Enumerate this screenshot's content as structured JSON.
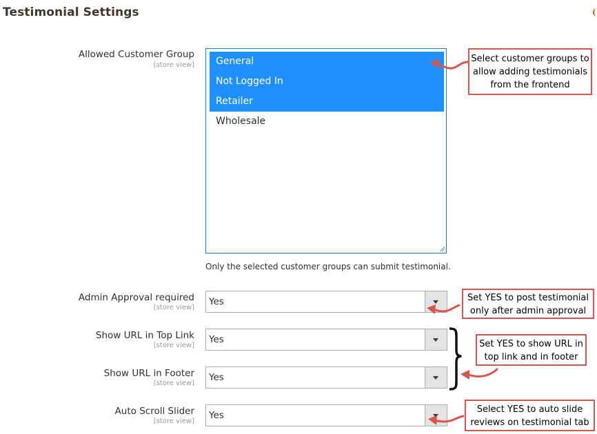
{
  "section": {
    "title": "Testimonial Settings"
  },
  "fields": {
    "allowed_customer_group": {
      "label": "Allowed Customer Group",
      "scope": "[store view]",
      "options": [
        {
          "label": "General",
          "selected": true
        },
        {
          "label": "Not Logged In",
          "selected": true
        },
        {
          "label": "Retailer",
          "selected": true
        },
        {
          "label": "Wholesale",
          "selected": false
        }
      ],
      "hint": "Only the selected customer groups can submit testimonial."
    },
    "admin_approval": {
      "label": "Admin Approval required",
      "scope": "[store view]",
      "value": "Yes"
    },
    "show_url_top_link": {
      "label": "Show URL in Top Link",
      "scope": "[store view]",
      "value": "Yes"
    },
    "show_url_footer": {
      "label": "Show URL in Footer",
      "scope": "[store view]",
      "value": "Yes"
    },
    "auto_scroll_slider": {
      "label": "Auto Scroll Slider",
      "scope": "[store view]",
      "value": "Yes"
    }
  },
  "annotations": {
    "customer_groups": [
      "Select customer groups to",
      "allow adding testimonials",
      "from the frontend"
    ],
    "admin_approval": [
      "Set YES to post testimonial",
      "only after admin approval"
    ],
    "show_url": [
      "Set YES to show URL in",
      "top link and in footer"
    ],
    "auto_slide": [
      "Select YES to auto slide",
      "reviews on testimonial tab"
    ]
  },
  "colors": {
    "selected_bg": "#1e90ff",
    "focus_border": "#1979c3",
    "annotation_red": "#d9534f",
    "title_accent": "#eb5202"
  }
}
